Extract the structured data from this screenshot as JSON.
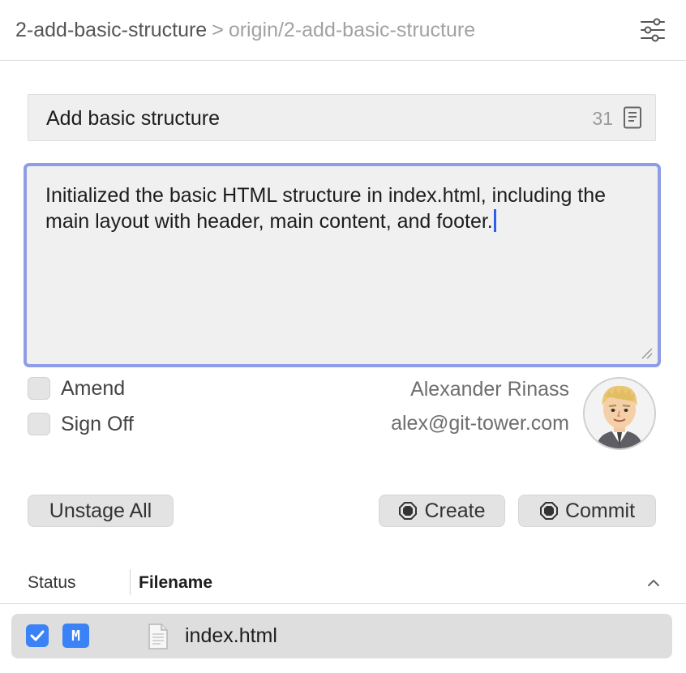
{
  "header": {
    "branch": "2-add-basic-structure",
    "separator": ">",
    "remote": "origin/2-add-basic-structure",
    "settings_icon": "sliders-icon"
  },
  "commit": {
    "summary": "Add basic structure",
    "char_count": "31",
    "template_icon": "document-icon",
    "description": "Initialized the basic HTML structure in index.html, including the main layout with header, main content, and footer."
  },
  "options": {
    "amend_label": "Amend",
    "amend_checked": false,
    "signoff_label": "Sign Off",
    "signoff_checked": false
  },
  "author": {
    "name": "Alexander Rinass",
    "email": "alex@git-tower.com"
  },
  "buttons": {
    "unstage_all": "Unstage All",
    "create": "Create",
    "commit": "Commit"
  },
  "file_list": {
    "columns": {
      "status": "Status",
      "filename": "Filename"
    },
    "rows": [
      {
        "checked": true,
        "status": "M",
        "filename": "index.html"
      }
    ]
  },
  "colors": {
    "accent": "#3b82f6",
    "focus_ring": "#8f9de6",
    "caret": "#2f5fe8"
  }
}
